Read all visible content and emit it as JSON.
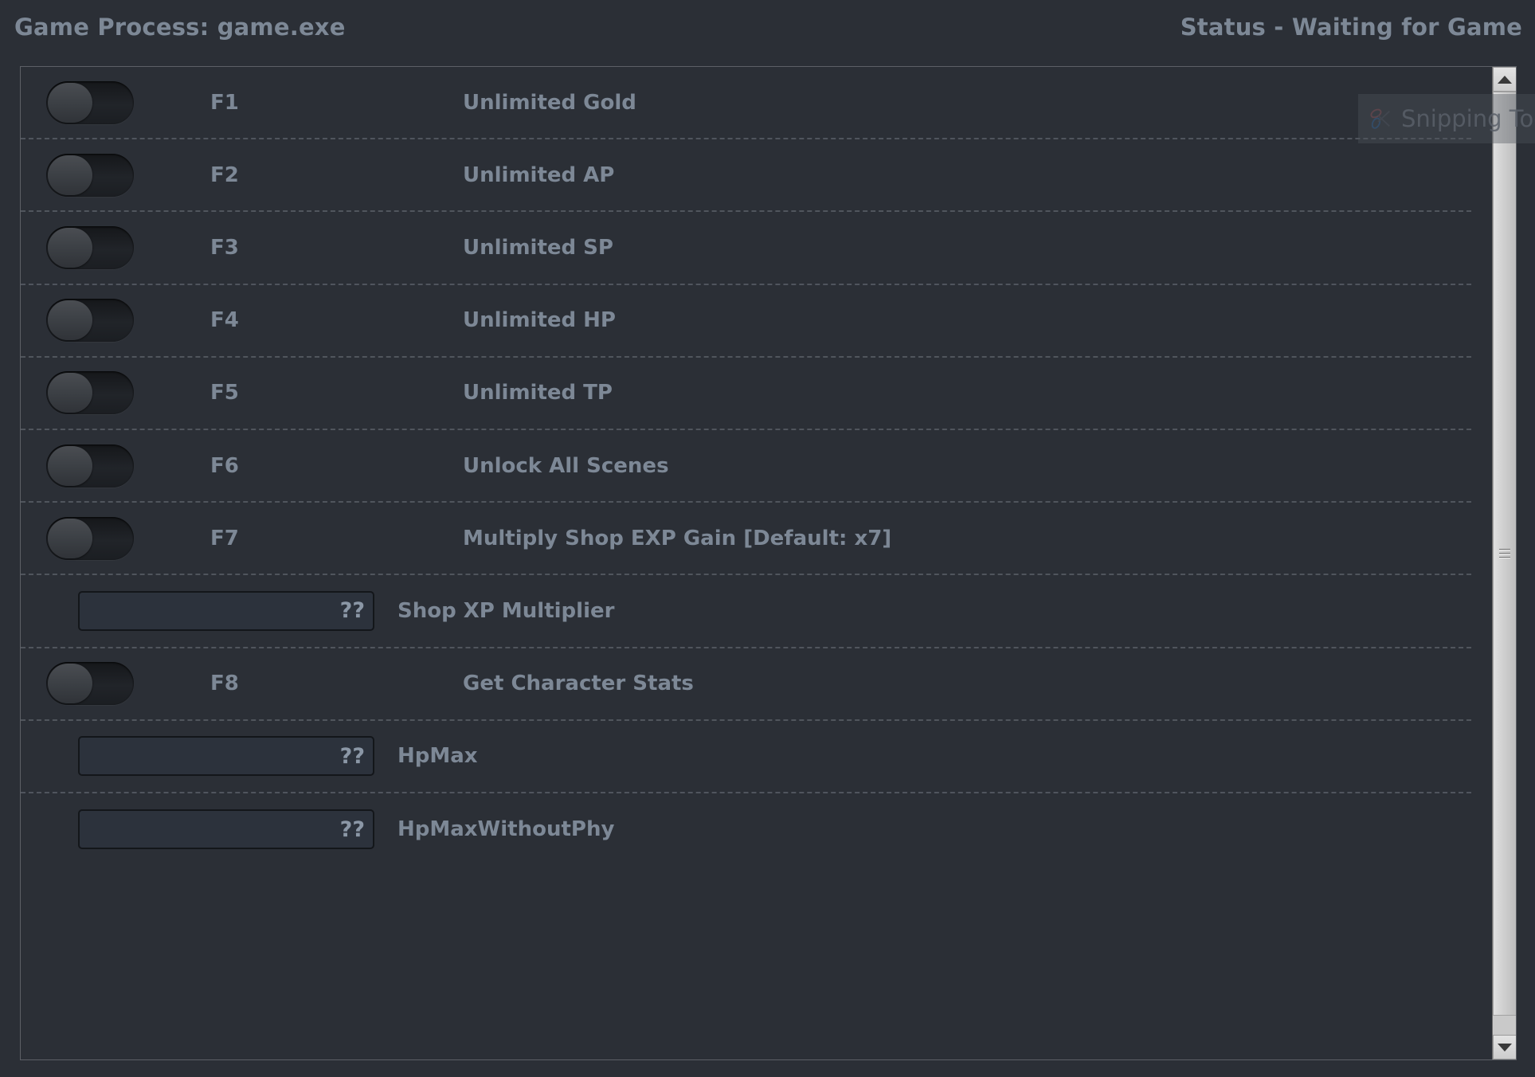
{
  "header": {
    "process_label": "Game Process: game.exe",
    "status_label": "Status - Waiting for Game"
  },
  "colors": {
    "background": "#2b2f36",
    "text": "#7d8896",
    "panel_border": "#5d6066",
    "divider": "#50555d",
    "input_bg": "#2c323c",
    "input_border": "#13161a",
    "scrollbar": "#d4d4d4"
  },
  "overlay": {
    "label": "Snipping Tool",
    "icon": "scissors-icon"
  },
  "scrollbar": {
    "up_icon": "arrow-up-icon",
    "down_icon": "arrow-down-icon",
    "grip_icon": "grip-lines-icon"
  },
  "rows": [
    {
      "type": "toggle",
      "hotkey": "F1",
      "label": "Unlimited Gold",
      "state": "off"
    },
    {
      "type": "toggle",
      "hotkey": "F2",
      "label": "Unlimited AP",
      "state": "off"
    },
    {
      "type": "toggle",
      "hotkey": "F3",
      "label": "Unlimited SP",
      "state": "off"
    },
    {
      "type": "toggle",
      "hotkey": "F4",
      "label": "Unlimited HP",
      "state": "off"
    },
    {
      "type": "toggle",
      "hotkey": "F5",
      "label": "Unlimited TP",
      "state": "off"
    },
    {
      "type": "toggle",
      "hotkey": "F6",
      "label": "Unlock All Scenes",
      "state": "off"
    },
    {
      "type": "toggle",
      "hotkey": "F7",
      "label": "Multiply Shop EXP Gain [Default: x7]",
      "state": "off"
    },
    {
      "type": "input",
      "value": "??",
      "label": "Shop XP Multiplier"
    },
    {
      "type": "toggle",
      "hotkey": "F8",
      "label": "Get Character Stats",
      "state": "off"
    },
    {
      "type": "input",
      "value": "??",
      "label": "HpMax"
    },
    {
      "type": "input",
      "value": "??",
      "label": "HpMaxWithoutPhy"
    }
  ]
}
